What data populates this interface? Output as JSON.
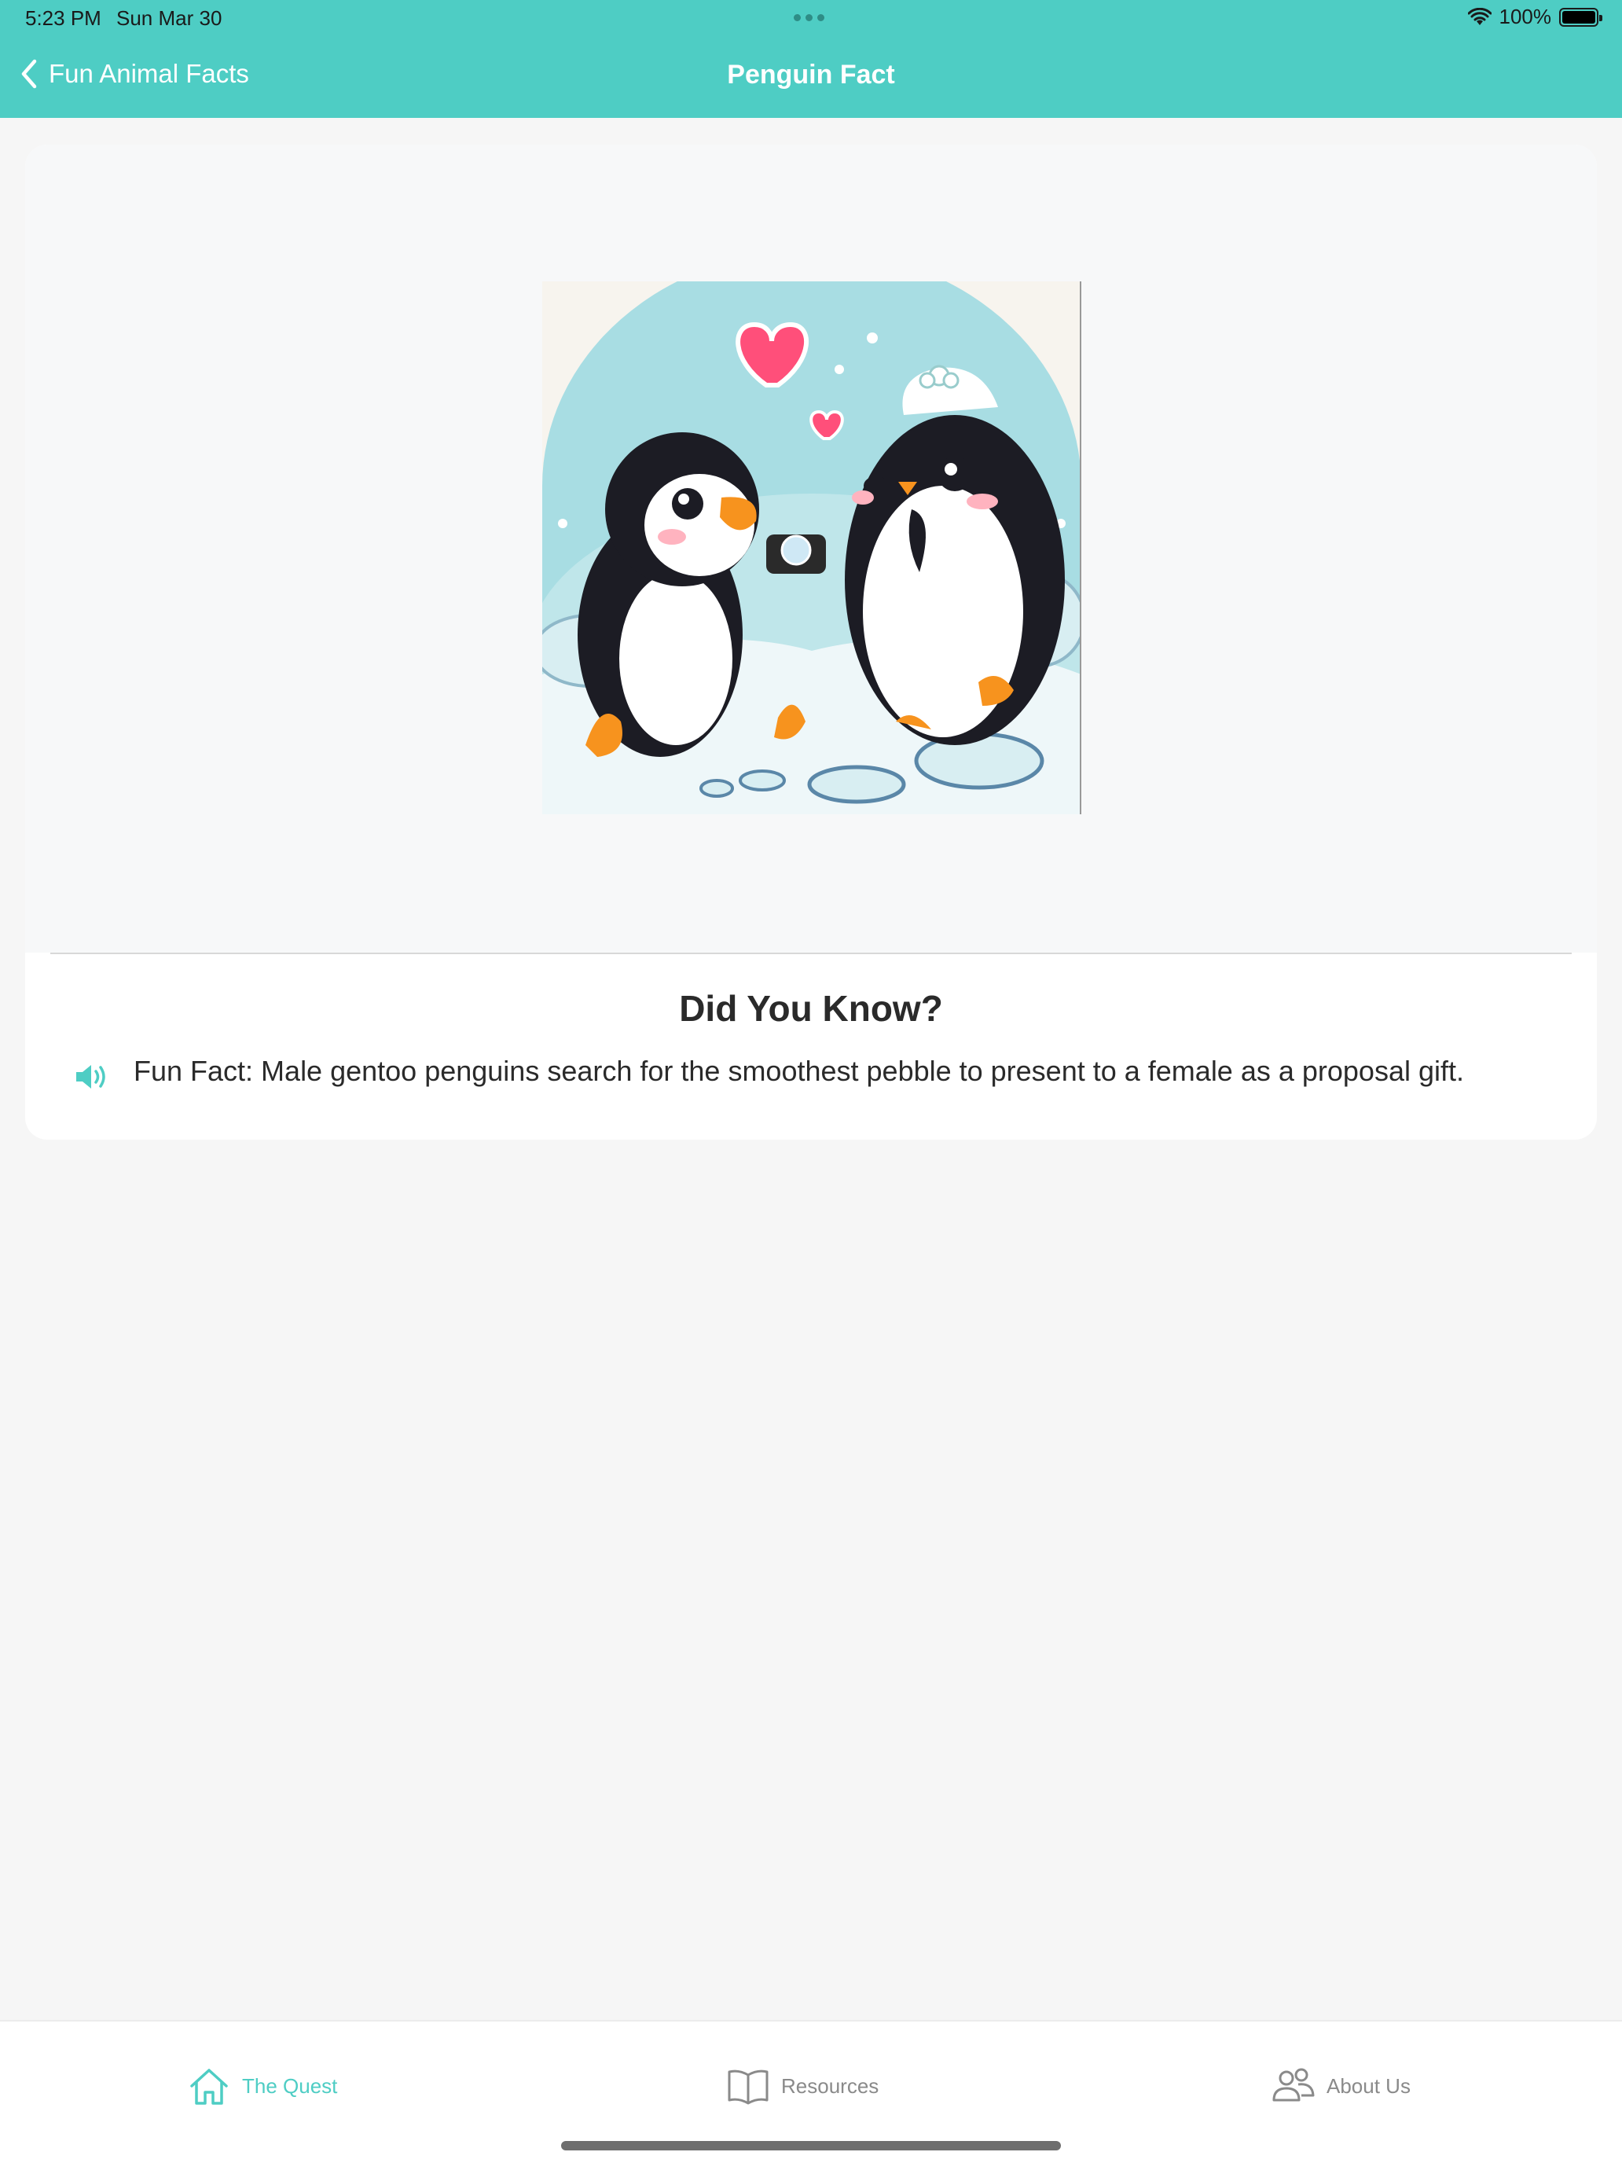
{
  "status_bar": {
    "time": "5:23 PM",
    "date": "Sun Mar 30",
    "battery": "100%"
  },
  "nav": {
    "back_label": "Fun Animal Facts",
    "title": "Penguin Fact"
  },
  "fact_card": {
    "heading": "Did You Know?",
    "text": "Fun Fact: Male gentoo penguins search for the smoothest pebble to present to a female as a proposal gift.",
    "speaker_icon": "speaker-icon",
    "image_icon": "penguin-proposal-illustration"
  },
  "tabs": [
    {
      "label": "The Quest",
      "icon": "home-icon",
      "active": true
    },
    {
      "label": "Resources",
      "icon": "book-icon",
      "active": false
    },
    {
      "label": "About Us",
      "icon": "people-icon",
      "active": false
    }
  ],
  "colors": {
    "accent": "#4ecdc4",
    "background": "#f6f6f6",
    "card": "#ffffff",
    "text": "#2a2a2a",
    "inactive_tab": "#8a8a8a"
  }
}
